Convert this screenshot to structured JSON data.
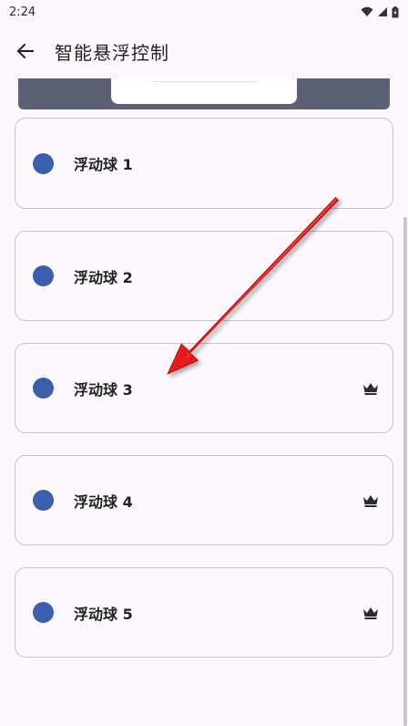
{
  "status_bar": {
    "time": "2:24",
    "icons": [
      "wifi-icon",
      "signal-icon",
      "battery-icon"
    ]
  },
  "app_bar": {
    "back_icon": "arrow-left-icon",
    "title": "智能悬浮控制"
  },
  "balls": [
    {
      "label": "浮动球 1",
      "premium": false
    },
    {
      "label": "浮动球 2",
      "premium": false
    },
    {
      "label": "浮动球 3",
      "premium": true
    },
    {
      "label": "浮动球 4",
      "premium": true
    },
    {
      "label": "浮动球 5",
      "premium": true
    }
  ],
  "colors": {
    "ball_dot": "#3b5fad",
    "annotation_arrow": "#e01010",
    "banner": "#5b6072"
  },
  "premium_icon": "crown-icon"
}
